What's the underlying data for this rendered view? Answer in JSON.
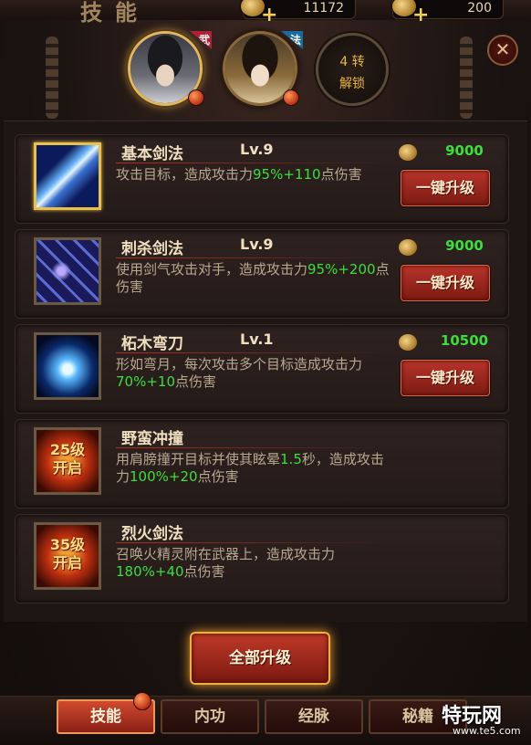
{
  "header": {
    "title": "技能"
  },
  "resources": [
    {
      "name": "coins",
      "value": "11172",
      "icon": "coin-stack-icon"
    },
    {
      "name": "ingots",
      "value": "200",
      "icon": "gold-ingot-icon"
    }
  ],
  "characters": [
    {
      "tag": "武",
      "active": true
    },
    {
      "tag": "法",
      "active": false
    }
  ],
  "locked_slot": {
    "line1": "4 转",
    "line2": "解锁"
  },
  "close_glyph": "✕",
  "skills": [
    {
      "name": "基本剑法",
      "level": "Lv.9",
      "desc_a": "攻击目标，造成攻击力",
      "desc_b": "95%+110",
      "desc_c": "点伤害",
      "cost": "9000",
      "button": "一键升级",
      "locked": false
    },
    {
      "name": "刺杀剑法",
      "level": "Lv.9",
      "desc_a": "使用剑气攻击对手，造成攻击力",
      "desc_b": "95%+200",
      "desc_c": "点伤害",
      "cost": "9000",
      "button": "一键升级",
      "locked": false
    },
    {
      "name": "柘木弯刀",
      "level": "Lv.1",
      "desc_a": "形如弯月，每次攻击多个目标造成攻击力",
      "desc_b": "70%+10",
      "desc_c": "点伤害",
      "cost": "10500",
      "button": "一键升级",
      "locked": false
    },
    {
      "name": "野蛮冲撞",
      "level": "",
      "desc_a": "用肩膀撞开目标并使其眩晕",
      "desc_b": "1.5",
      "desc_c": "秒，造成攻击力",
      "desc_d": "100%+20",
      "desc_e": "点伤害",
      "unlock_line1": "25级",
      "unlock_line2": "开启",
      "locked": true
    },
    {
      "name": "烈火剑法",
      "level": "",
      "desc_a": "召唤火精灵附在武器上，造成攻击力",
      "desc_b": "180%+40",
      "desc_c": "点伤害",
      "unlock_line1": "35级",
      "unlock_line2": "开启",
      "locked": true
    }
  ],
  "upgrade_all": "全部升级",
  "tabs": [
    {
      "label": "技能",
      "active": true
    },
    {
      "label": "内功",
      "active": false
    },
    {
      "label": "经脉",
      "active": false
    },
    {
      "label": "秘籍",
      "active": false
    }
  ],
  "watermark": {
    "main": "特玩网",
    "sub": "www.te5.com"
  }
}
